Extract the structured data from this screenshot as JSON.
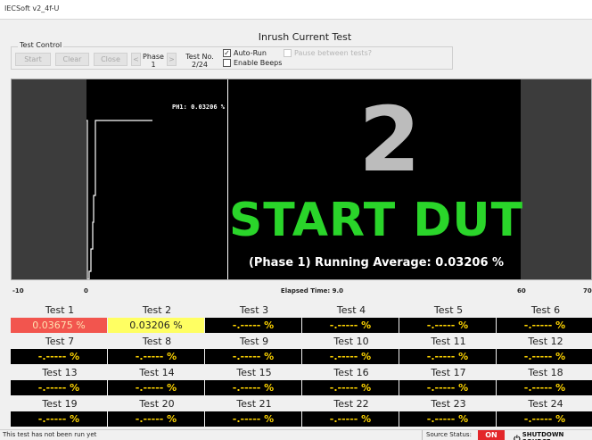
{
  "window": {
    "title": "IECSoft v2_4f-U"
  },
  "main_title": "Inrush Current Test",
  "test_control": {
    "legend": "Test Control",
    "start_label": "Start",
    "clear_label": "Clear",
    "close_label": "Close",
    "prev_label": "<",
    "next_label": ">",
    "phase_label": "Phase",
    "phase_value": "1",
    "testno_label": "Test No.",
    "testno_value": "2/24",
    "auto_run": {
      "label": "Auto-Run",
      "checked": true
    },
    "enable_beeps": {
      "label": "Enable Beeps",
      "checked": false
    },
    "pause_between": {
      "label": "Pause between tests?",
      "checked": false
    }
  },
  "display": {
    "ph_label": "PH1: 0.03206 %",
    "big_number": "2",
    "start_dut": "START DUT",
    "running_average": "(Phase 1) Running Average: 0.03206 %"
  },
  "axis": {
    "neg10": "-10",
    "zero": "0",
    "elapsed": "Elapsed Time: 9.0",
    "sixty": "60",
    "seventy": "70"
  },
  "tests": [
    {
      "name": "Test 1",
      "value": "0.03675 %",
      "state": "red"
    },
    {
      "name": "Test 2",
      "value": "0.03206 %",
      "state": "yellow"
    },
    {
      "name": "Test 3",
      "value": "-.----- %",
      "state": "pending"
    },
    {
      "name": "Test 4",
      "value": "-.----- %",
      "state": "pending"
    },
    {
      "name": "Test 5",
      "value": "-.----- %",
      "state": "pending"
    },
    {
      "name": "Test 6",
      "value": "-.----- %",
      "state": "pending"
    },
    {
      "name": "Test 7",
      "value": "-.----- %",
      "state": "pending"
    },
    {
      "name": "Test 8",
      "value": "-.----- %",
      "state": "pending"
    },
    {
      "name": "Test 9",
      "value": "-.----- %",
      "state": "pending"
    },
    {
      "name": "Test 10",
      "value": "-.----- %",
      "state": "pending"
    },
    {
      "name": "Test 11",
      "value": "-.----- %",
      "state": "pending"
    },
    {
      "name": "Test 12",
      "value": "-.----- %",
      "state": "pending"
    },
    {
      "name": "Test 13",
      "value": "-.----- %",
      "state": "pending"
    },
    {
      "name": "Test 14",
      "value": "-.----- %",
      "state": "pending"
    },
    {
      "name": "Test 15",
      "value": "-.----- %",
      "state": "pending"
    },
    {
      "name": "Test 16",
      "value": "-.----- %",
      "state": "pending"
    },
    {
      "name": "Test 17",
      "value": "-.----- %",
      "state": "pending"
    },
    {
      "name": "Test 18",
      "value": "-.----- %",
      "state": "pending"
    },
    {
      "name": "Test 19",
      "value": "-.----- %",
      "state": "pending"
    },
    {
      "name": "Test 20",
      "value": "-.----- %",
      "state": "pending"
    },
    {
      "name": "Test 21",
      "value": "-.----- %",
      "state": "pending"
    },
    {
      "name": "Test 22",
      "value": "-.----- %",
      "state": "pending"
    },
    {
      "name": "Test 23",
      "value": "-.----- %",
      "state": "pending"
    },
    {
      "name": "Test 24",
      "value": "-.----- %",
      "state": "pending"
    }
  ],
  "status_bar": {
    "message": "This test has not been run yet",
    "source_status_label": "Source Status:",
    "source_status_value": "ON",
    "shutdown_label": "SHUTDOWN SOURCE",
    "shutdown_icon": "power-icon"
  },
  "colors": {
    "start_dut": "#2ad52a",
    "fail_red": "#f2554e",
    "active_yellow": "#ffff62",
    "pending_text": "#ffd500",
    "source_on": "#e3262a"
  }
}
